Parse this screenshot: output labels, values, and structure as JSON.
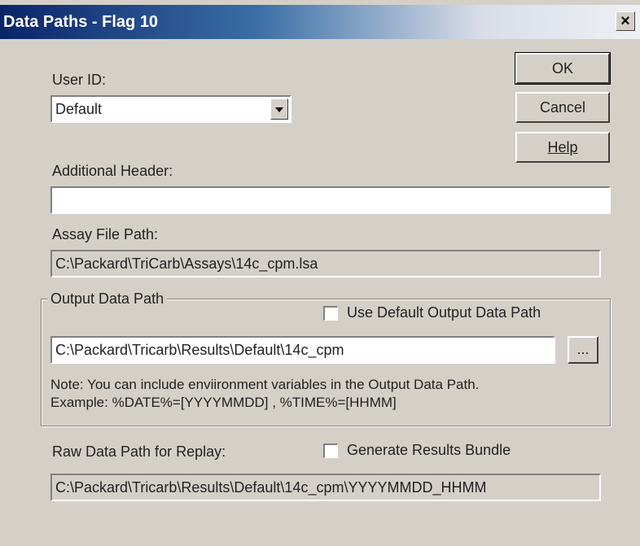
{
  "window": {
    "title": "Data Paths - Flag 10",
    "close_glyph": "×"
  },
  "user_id": {
    "label": "User ID:",
    "selected": "Default"
  },
  "buttons": {
    "ok": "OK",
    "cancel": "Cancel",
    "help": "Help"
  },
  "additional_header": {
    "label": "Additional Header:",
    "value": ""
  },
  "assay_file_path": {
    "label": "Assay File Path:",
    "value": "C:\\Packard\\TriCarb\\Assays\\14c_cpm.lsa"
  },
  "output_data_path": {
    "group_label": "Output Data Path",
    "use_default_label": "Use Default Output Data Path",
    "use_default_checked": false,
    "value": "C:\\Packard\\Tricarb\\Results\\Default\\14c_cpm",
    "browse_label": "...",
    "note_line1": "Note: You can include enviironment variables in the Output Data Path.",
    "note_line2": "Example:  %DATE%=[YYYYMMDD] ,    %TIME%=[HHMM]"
  },
  "raw_data_path": {
    "label": "Raw Data Path for Replay:",
    "generate_bundle_label": "Generate Results Bundle",
    "generate_bundle_checked": false,
    "value": "C:\\Packard\\Tricarb\\Results\\Default\\14c_cpm\\YYYYMMDD_HHMM"
  }
}
